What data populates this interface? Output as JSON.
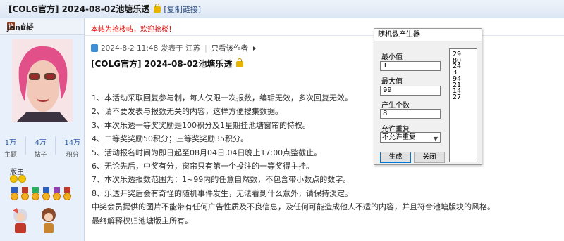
{
  "thread": {
    "title": "[COLG官方] 2024-08-02池塘乐透",
    "copy_link": "[复制链接]"
  },
  "left": {
    "grab_label": "抢楼",
    "username": "janus",
    "stats": [
      {
        "value": "1万",
        "label": "主题"
      },
      {
        "value": "4万",
        "label": "帖子"
      },
      {
        "value": "14万",
        "label": "积分"
      }
    ],
    "role": "版主"
  },
  "notice": "本帖为抢楼帖，欢迎抢楼！",
  "post": {
    "date": "2024-8-2 11:48",
    "posted_from": "发表于 江苏",
    "only_author": "只看该作者",
    "title": "[COLG官方] 2024-08-02池塘乐透",
    "lines": [
      "1、本活动采取回复参与制，每人仅限一次报数，编辑无效，多次回复无效。",
      "2、请不要发表与报数无关的内容，这样方便搜集数据。",
      "3、本次乐透一等奖奖励是100积分及1星期挂池塘窗帘的特权。",
      "4、二等奖奖励50积分；三等奖奖励35积分。",
      "5、活动报名时间为即日起至08月04日,04日晚上17:00点整截止。",
      "6、无论先后，中奖有分，窗帘只有第一个投注的一等奖得主挂。",
      "7、本次乐透报数范围为：1~99内的任意自然数，不包含带小数点的数字。",
      "8、乐透开奖后会有奇怪的随机事件发生，无法看到什么意外，请保持淡定。",
      "中奖会员提供的图片不能带有任何广告性质及不良信息，及任何可能造成他人不适的内容，并且符合池塘版块的风格。",
      "最终解释权归池塘版主所有。"
    ]
  },
  "dialog": {
    "title": "随机数产生器",
    "min_label": "最小值",
    "min_value": "1",
    "max_label": "最大值",
    "max_value": "99",
    "count_label": "产生个数",
    "count_value": "8",
    "repeat_label": "允许重复",
    "repeat_value": "不允许重复",
    "generate_label": "生成",
    "close_label": "关闭",
    "results": [
      "29",
      "80",
      "24",
      "3",
      "94",
      "21",
      "14",
      "27"
    ]
  },
  "colors": {
    "notice_red": "#e00000",
    "sidebar_bg": "#e8f0fb",
    "stat_blue": "#2a5db0"
  }
}
